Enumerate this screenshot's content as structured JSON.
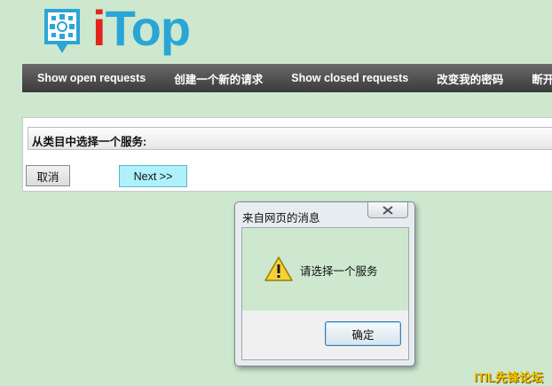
{
  "logo": {
    "text": "iTop",
    "brand_color": "#2aa6d6",
    "dot_color": "#e2231a"
  },
  "nav": {
    "items": [
      {
        "label": "Show open requests"
      },
      {
        "label": "创建一个新的请求"
      },
      {
        "label": "Show closed requests"
      },
      {
        "label": "改变我的密码"
      },
      {
        "label": "断开"
      }
    ]
  },
  "panel": {
    "header": "从类目中选择一个服务:",
    "cancel_label": "取消",
    "next_label": "Next >>"
  },
  "dialog": {
    "title": "来自网页的消息",
    "close_icon": "close-icon",
    "message": "请选择一个服务",
    "icon": "warning-icon",
    "ok_label": "确定"
  },
  "watermark": "ITIL先锋论坛"
}
